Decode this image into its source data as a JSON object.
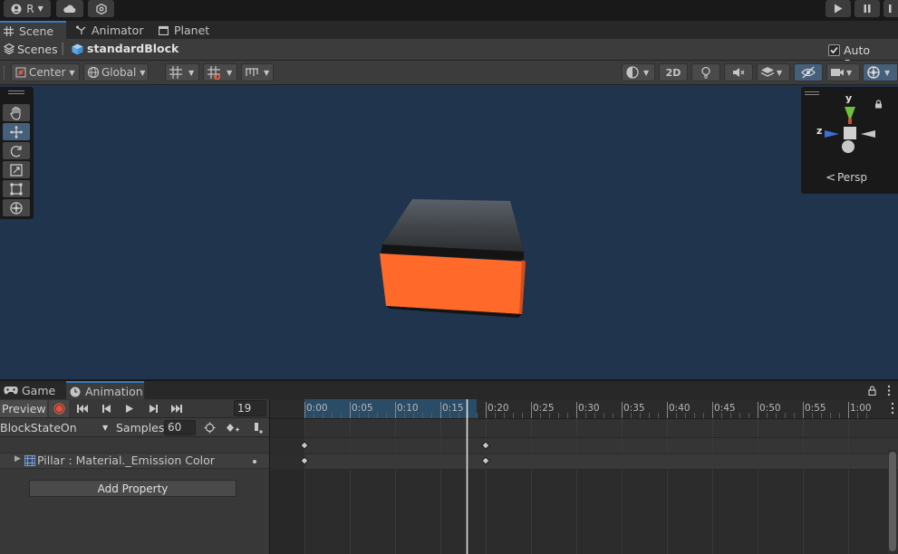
{
  "topbar": {
    "account_label": "R",
    "account_icon": "account-icon",
    "cloud_icon": "cloud-icon",
    "settings_icon": "settings-icon",
    "play_icon": "play-icon",
    "pause_icon": "pause-icon",
    "menu_icon": "kebab-icon"
  },
  "tabs": [
    {
      "label": "Scene",
      "icon": "grid-icon"
    },
    {
      "label": "Animator",
      "icon": "animator-icon"
    },
    {
      "label": "Planet",
      "icon": "planet-icon"
    }
  ],
  "breadcrumb": {
    "root": "Scenes",
    "current": "standardBlock",
    "auto_save_label": "Auto Save",
    "auto_save_checked": true
  },
  "scene_toolbar": {
    "pivot_mode": "Center",
    "pivot_space": "Global",
    "mode_2d_label": "2D"
  },
  "gizmo": {
    "y_label": "y",
    "z_label": "z",
    "persp_label": "Persp"
  },
  "colors": {
    "accent": "#3a79bb",
    "viewport_bg": "#20344d",
    "cube_front": "#ff6a2a",
    "record": "#e55139",
    "axis_y": "#6ec13b",
    "axis_z": "#3d6fd8"
  },
  "anim_tabs": [
    {
      "label": "Game",
      "icon": "gamepad-icon"
    },
    {
      "label": "Animation",
      "icon": "clock-icon"
    }
  ],
  "animation": {
    "preview_label": "Preview",
    "frame_value": "19",
    "clip_name": "BlockStateOn",
    "samples_label": "Samples",
    "samples_value": "60",
    "property_label": "Pillar : Material._Emission Color",
    "add_property_label": "Add Property",
    "timeline_labels": [
      "0:00",
      "0:05",
      "0:10",
      "0:15",
      "0:20",
      "0:25",
      "0:30",
      "0:35",
      "0:40",
      "0:45",
      "0:50",
      "0:55",
      "1:00"
    ],
    "current_frame": 19,
    "keyframes": [
      0,
      20
    ]
  }
}
